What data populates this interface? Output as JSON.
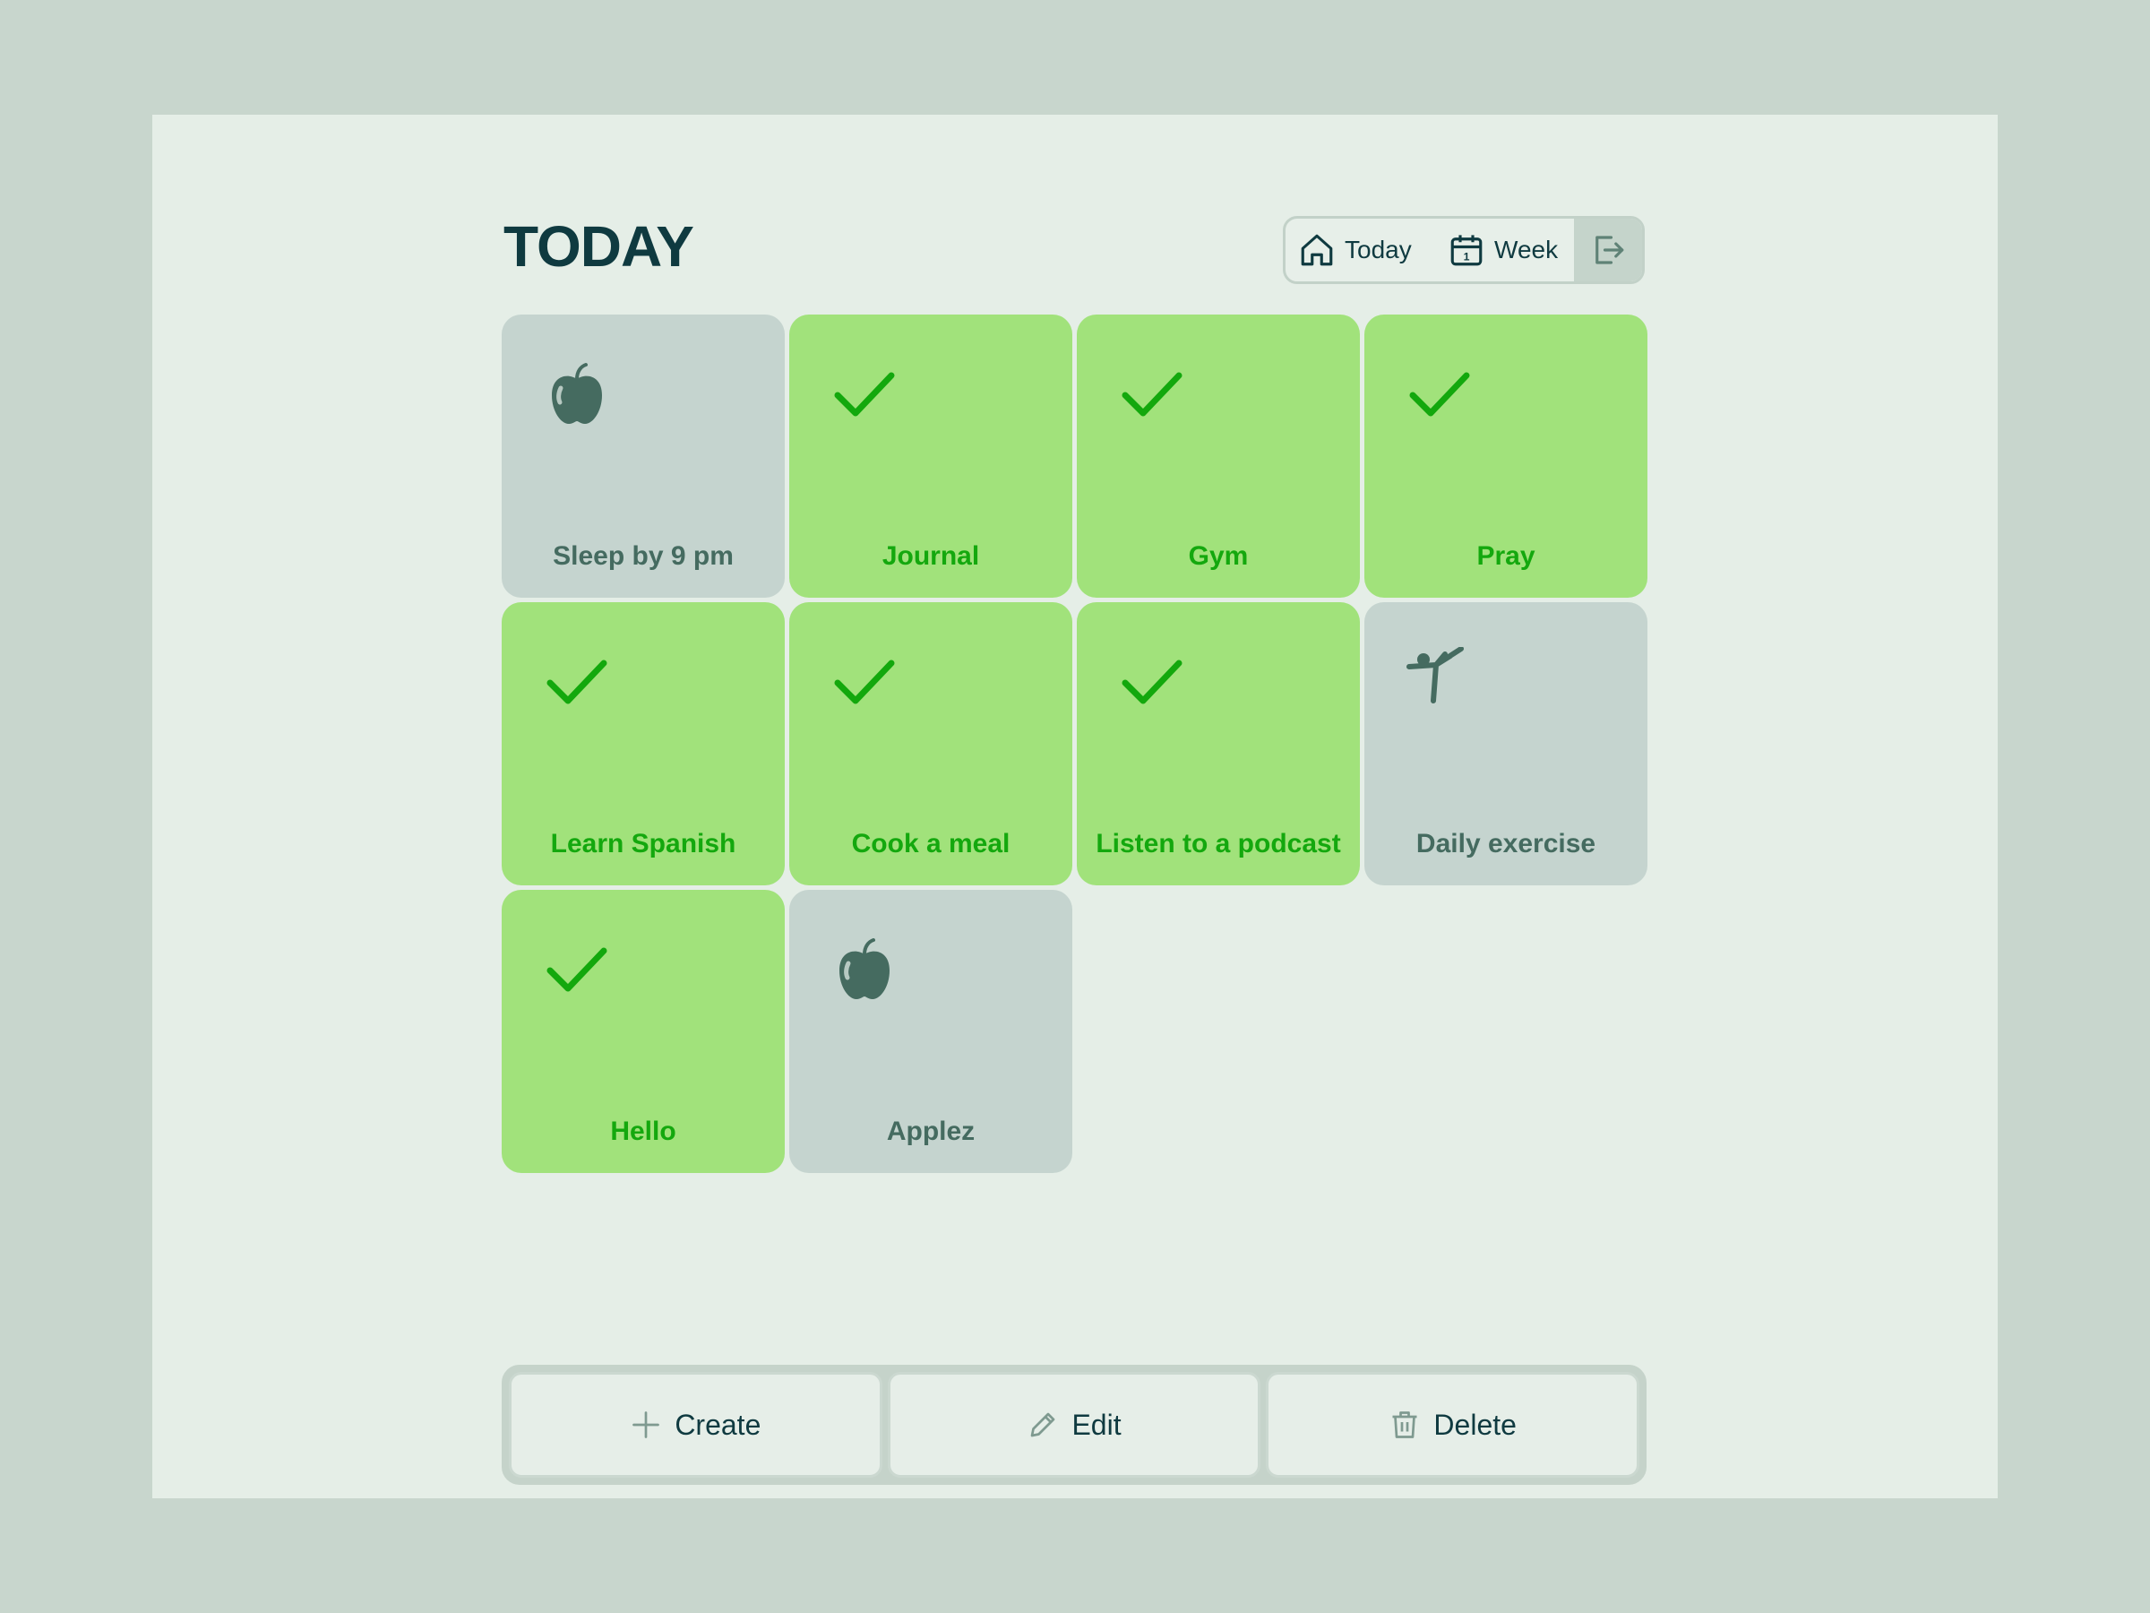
{
  "page": {
    "title": "TODAY"
  },
  "nav": {
    "today_label": "Today",
    "week_label": "Week",
    "logout_icon": "logout-icon",
    "week_icon_day": "1"
  },
  "habits": [
    {
      "label": "Sleep by 9 pm",
      "status": "todo",
      "icon": "apple-icon"
    },
    {
      "label": "Journal",
      "status": "done",
      "icon": "check-icon"
    },
    {
      "label": "Gym",
      "status": "done",
      "icon": "check-icon"
    },
    {
      "label": "Pray",
      "status": "done",
      "icon": "check-icon"
    },
    {
      "label": "Learn Spanish",
      "status": "done",
      "icon": "check-icon"
    },
    {
      "label": "Cook a meal",
      "status": "done",
      "icon": "check-icon"
    },
    {
      "label": "Listen to a podcast",
      "status": "done",
      "icon": "check-icon"
    },
    {
      "label": "Daily exercise",
      "status": "todo",
      "icon": "martial-arts-icon"
    },
    {
      "label": "Hello",
      "status": "done",
      "icon": "check-icon"
    },
    {
      "label": "Applez",
      "status": "todo",
      "icon": "apple-icon"
    }
  ],
  "toolbar": {
    "create_label": "Create",
    "edit_label": "Edit",
    "delete_label": "Delete"
  },
  "colors": {
    "done_bg": "#a1e27b",
    "done_text": "#14a80e",
    "todo_bg": "#c5d4cf",
    "todo_text": "#456b60",
    "heading": "#0f3a40"
  }
}
